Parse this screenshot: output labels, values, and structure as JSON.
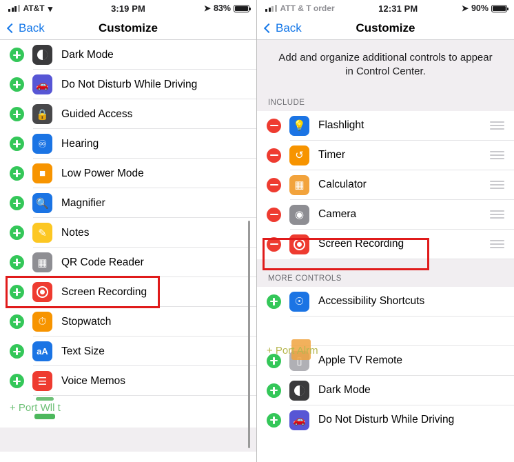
{
  "left": {
    "status": {
      "carrier": "AT&T",
      "wifi_icon": "wifi-icon",
      "time": "3:19 PM",
      "location_icon": "location-arrow-icon",
      "battery_pct": "83%"
    },
    "nav": {
      "back_label": "Back",
      "title": "Customize"
    },
    "items": [
      {
        "action": "add",
        "icon": "dark-mode-icon",
        "label": "Dark Mode"
      },
      {
        "action": "add",
        "icon": "do-not-disturb-driving-icon",
        "label": "Do Not Disturb While Driving"
      },
      {
        "action": "add",
        "icon": "guided-access-icon",
        "label": "Guided Access"
      },
      {
        "action": "add",
        "icon": "hearing-icon",
        "label": "Hearing"
      },
      {
        "action": "add",
        "icon": "low-power-mode-icon",
        "label": "Low Power Mode"
      },
      {
        "action": "add",
        "icon": "magnifier-icon",
        "label": "Magnifier"
      },
      {
        "action": "add",
        "icon": "notes-icon",
        "label": "Notes"
      },
      {
        "action": "add",
        "icon": "qr-code-reader-icon",
        "label": "QR Code Reader"
      },
      {
        "action": "add",
        "icon": "screen-recording-icon",
        "label": "Screen Recording"
      },
      {
        "action": "add",
        "icon": "stopwatch-icon",
        "label": "Stopwatch"
      },
      {
        "action": "add",
        "icon": "text-size-icon",
        "label": "Text Size"
      },
      {
        "action": "add",
        "icon": "voice-memos-icon",
        "label": "Voice Memos"
      }
    ],
    "artifact": "+ Port Wll t",
    "highlight_color": "#e01b1b"
  },
  "right": {
    "status": {
      "carrier": "ATT & T order",
      "time": "12:31 PM",
      "location_icon": "location-arrow-icon",
      "battery_pct": "90%"
    },
    "nav": {
      "back_label": "Back",
      "title": "Customize"
    },
    "intro": "Add and organize additional controls to appear in Control Center.",
    "include_header": "INCLUDE",
    "include_items": [
      {
        "action": "remove",
        "icon": "flashlight-icon",
        "label": "Flashlight"
      },
      {
        "action": "remove",
        "icon": "timer-icon",
        "label": "Timer"
      },
      {
        "action": "remove",
        "icon": "calculator-icon",
        "label": "Calculator"
      },
      {
        "action": "remove",
        "icon": "camera-icon",
        "label": "Camera"
      },
      {
        "action": "remove",
        "icon": "screen-recording-icon",
        "label": "Screen Recording"
      }
    ],
    "more_header": "MORE CONTROLS",
    "more_items": [
      {
        "action": "add",
        "icon": "accessibility-shortcuts-icon",
        "label": "Accessibility Shortcuts"
      },
      {
        "action": "add",
        "icon": "apple-tv-remote-icon",
        "label": "Apple TV Remote"
      },
      {
        "action": "add",
        "icon": "dark-mode-icon",
        "label": "Dark Mode"
      },
      {
        "action": "add",
        "icon": "do-not-disturb-driving-icon",
        "label": "Do Not Disturb While Driving"
      }
    ],
    "artifact": "+ Port Alrm",
    "highlight_color": "#e01b1b"
  }
}
